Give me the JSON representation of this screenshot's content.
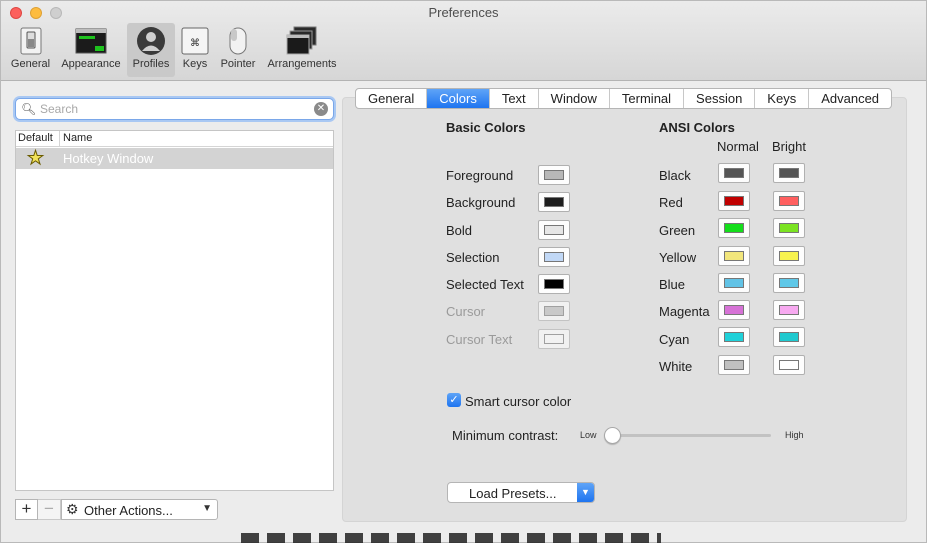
{
  "window": {
    "title": "Preferences"
  },
  "toolbar": {
    "items": [
      {
        "label": "General",
        "icon": "switch-icon"
      },
      {
        "label": "Appearance",
        "icon": "appearance-icon"
      },
      {
        "label": "Profiles",
        "icon": "profile-icon"
      },
      {
        "label": "Keys",
        "icon": "keyboard-icon"
      },
      {
        "label": "Pointer",
        "icon": "mouse-icon"
      },
      {
        "label": "Arrangements",
        "icon": "arrangements-icon"
      }
    ],
    "selected": "Profiles"
  },
  "search": {
    "placeholder": "Search",
    "value": ""
  },
  "profiles_table": {
    "columns": [
      "Default",
      "Name"
    ],
    "rows": [
      {
        "default": true,
        "name": "Hotkey Window"
      }
    ]
  },
  "bottom_bar": {
    "add": "+",
    "remove": "−",
    "other_actions": "Other Actions..."
  },
  "tabs": [
    "General",
    "Colors",
    "Text",
    "Window",
    "Terminal",
    "Session",
    "Keys",
    "Advanced"
  ],
  "active_tab": "Colors",
  "basic_colors": {
    "title": "Basic Colors",
    "items": [
      {
        "label": "Foreground",
        "color": "#b8b8b8",
        "enabled": true
      },
      {
        "label": "Background",
        "color": "#1e1e1e",
        "enabled": true
      },
      {
        "label": "Bold",
        "color": "#e6e6e6",
        "enabled": true
      },
      {
        "label": "Selection",
        "color": "#c1d8f6",
        "enabled": true
      },
      {
        "label": "Selected Text",
        "color": "#000000",
        "enabled": true
      },
      {
        "label": "Cursor",
        "color": "#bbbbbb",
        "enabled": false
      },
      {
        "label": "Cursor Text",
        "color": "#ffffff",
        "enabled": false
      }
    ]
  },
  "ansi_colors": {
    "title": "ANSI Colors",
    "normal_label": "Normal",
    "bright_label": "Bright",
    "items": [
      {
        "label": "Black",
        "normal": "#555555",
        "bright": "#555555"
      },
      {
        "label": "Red",
        "normal": "#c00000",
        "bright": "#ff5f5f"
      },
      {
        "label": "Green",
        "normal": "#14de1b",
        "bright": "#7be322"
      },
      {
        "label": "Yellow",
        "normal": "#f2e67c",
        "bright": "#f7f34f"
      },
      {
        "label": "Blue",
        "normal": "#62c3e6",
        "bright": "#5fc8e8"
      },
      {
        "label": "Magenta",
        "normal": "#d672d6",
        "bright": "#f7a9f0"
      },
      {
        "label": "Cyan",
        "normal": "#1fd1d9",
        "bright": "#1fc9cf"
      },
      {
        "label": "White",
        "normal": "#c0c0c0",
        "bright": "#ffffff"
      }
    ]
  },
  "smart_cursor": {
    "label": "Smart cursor color",
    "checked": true
  },
  "minimum_contrast": {
    "label": "Minimum contrast:",
    "low": "Low",
    "high": "High",
    "value": 0.0
  },
  "load_presets": {
    "label": "Load Presets..."
  },
  "accent_color": "#1e74f0"
}
